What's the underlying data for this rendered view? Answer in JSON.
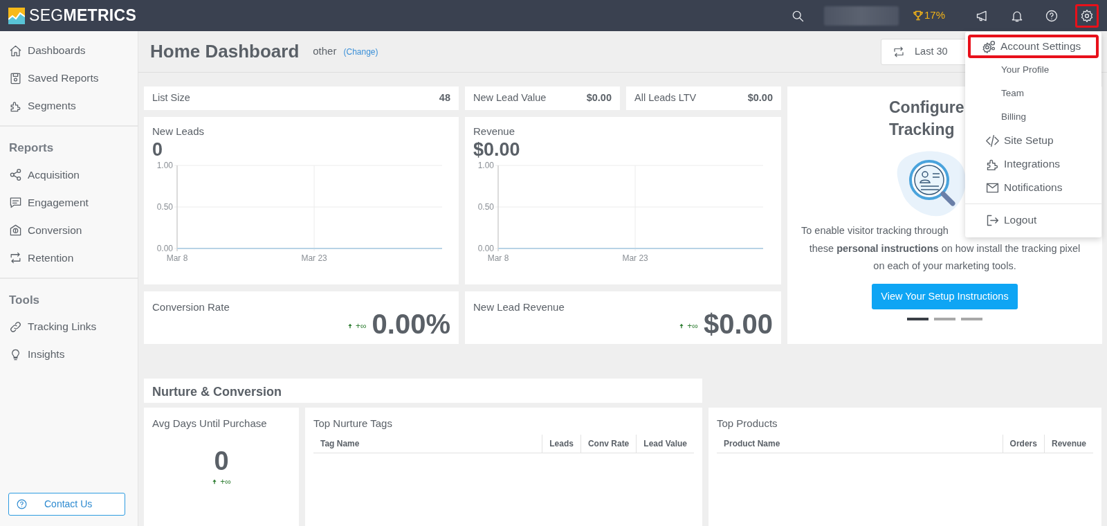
{
  "topbar": {
    "logo": "SEG**METRICS**",
    "achievement": "17%",
    "toolbar_buttons": [
      {
        "highlighted": false
      },
      {
        "highlighted": false
      },
      {
        "highlighted": false
      },
      {
        "highlighted": true
      }
    ]
  },
  "sidebar": {
    "groups": [
      {
        "items": [
          {
            "label": "Dashboards"
          },
          {
            "label": "Saved Reports"
          },
          {
            "label": "Segments"
          }
        ]
      },
      {
        "heading": "Reports",
        "items": [
          {
            "label": "Acquisition"
          },
          {
            "label": "Engagement"
          },
          {
            "label": "Conversion"
          },
          {
            "label": "Retention"
          }
        ]
      },
      {
        "heading": "Tools",
        "items": [
          {
            "label": "Tracking Links"
          },
          {
            "label": "Insights"
          }
        ]
      }
    ],
    "contact_button": "Contact Us"
  },
  "header": {
    "title": "Home Dashboard",
    "dashboard_type": "other",
    "change_link": "(Change)",
    "date_range": "Last 30"
  },
  "stats": [
    {
      "label": "List Size",
      "value": "48"
    },
    {
      "label": "New Lead Value",
      "value": "$0.00"
    },
    {
      "label": "All Leads LTV",
      "value": "$0.00"
    }
  ],
  "charts": [
    {
      "title": "New Leads",
      "value": "0",
      "chart_data": {
        "type": "line",
        "categories": [
          "Mar 8",
          null,
          null,
          null,
          null,
          null,
          null,
          null,
          null,
          null,
          null,
          null,
          null,
          null,
          null,
          "Mar 23",
          null,
          null,
          null,
          null,
          null,
          null,
          null,
          null,
          null,
          null,
          null,
          null,
          null,
          null
        ],
        "ylim": [
          0,
          1
        ],
        "yticks": [
          {
            "value": 0,
            "label": "0.00"
          },
          {
            "value": 0.5,
            "label": "0.50"
          },
          {
            "value": 1,
            "label": "1.00"
          }
        ],
        "series": [
          {
            "color": "#b7d3e6",
            "values": [
              0,
              0,
              0,
              0,
              0,
              0,
              0,
              0,
              0,
              0,
              0,
              0,
              0,
              0,
              0,
              0,
              0,
              0,
              0,
              0,
              0,
              0,
              0,
              0,
              0,
              0,
              0,
              0,
              0,
              0
            ]
          }
        ]
      }
    },
    {
      "title": "Revenue",
      "value": "$0.00",
      "chart_data": {
        "type": "line",
        "categories": [
          "Mar 8",
          null,
          null,
          null,
          null,
          null,
          null,
          null,
          null,
          null,
          null,
          null,
          null,
          null,
          null,
          "Mar 23",
          null,
          null,
          null,
          null,
          null,
          null,
          null,
          null,
          null,
          null,
          null,
          null,
          null,
          null
        ],
        "ylim": [
          0,
          1
        ],
        "yticks": [
          {
            "value": 0,
            "label": "0.00"
          },
          {
            "value": 0.5,
            "label": "0.50"
          },
          {
            "value": 1,
            "label": "1.00"
          }
        ],
        "series": [
          {
            "color": "#b7d3e6",
            "values": [
              0,
              0,
              0,
              0,
              0,
              0,
              0,
              0,
              0,
              0,
              0,
              0,
              0,
              0,
              0,
              0,
              0,
              0,
              0,
              0,
              0,
              0,
              0,
              0,
              0,
              0,
              0,
              0,
              0,
              0
            ]
          }
        ]
      }
    }
  ],
  "kpis": [
    {
      "label": "Conversion Rate",
      "trend": {
        "text": "+∞"
      },
      "value": "0.00%"
    },
    {
      "label": "New Lead Revenue",
      "trend": {
        "text": "+∞"
      },
      "value": "$0.00"
    }
  ],
  "setup_panel": {
    "title_lines": [
      "Configure",
      "Tracking"
    ],
    "text_lines": [
      "To enable visitor tracking through",
      "these **personal instructions** on how install the tracking pixel",
      "on each of your marketing tools."
    ],
    "button": "View Your Setup Instructions",
    "slides": [
      {
        "selected": true
      },
      {
        "selected": false
      },
      {
        "selected": false
      }
    ]
  },
  "section_title": "Nurture & Conversion",
  "avg_days": {
    "label": "Avg Days Until Purchase",
    "value": "0",
    "trend": {
      "text": "+∞"
    }
  },
  "tables": [
    {
      "title": "Top Nurture Tags",
      "columns": [
        "Tag Name",
        "Leads",
        "Conv Rate",
        "Lead Value"
      ]
    },
    {
      "title": "Top Products",
      "columns": [
        "Product Name",
        "Orders",
        "Revenue"
      ]
    }
  ],
  "account_menu": {
    "items": [
      {
        "label": "Account Settings",
        "highlighted": true
      },
      {
        "label": "Your Profile",
        "highlighted": false
      },
      {
        "label": "Team",
        "highlighted": false
      },
      {
        "label": "Billing",
        "highlighted": false
      },
      {
        "label": "Site Setup",
        "highlighted": false
      },
      {
        "label": "Integrations",
        "highlighted": false
      },
      {
        "label": "Notifications",
        "highlighted": false
      }
    ],
    "footer_items": [
      {
        "label": "Logout"
      }
    ]
  }
}
